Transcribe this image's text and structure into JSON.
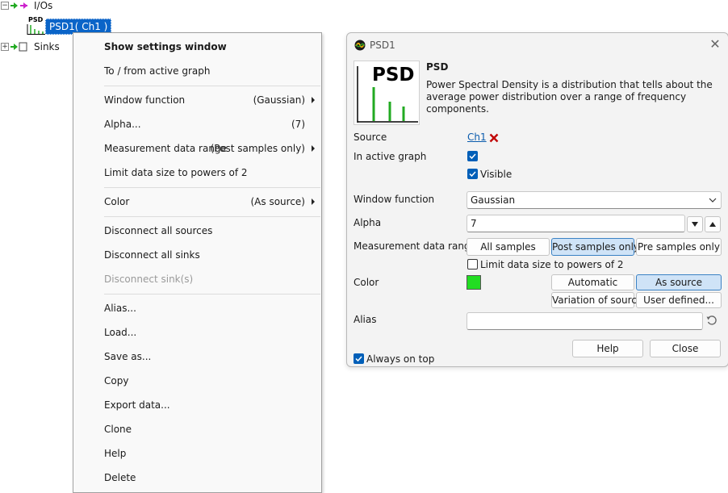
{
  "tree": {
    "ios_label": "I/Os",
    "psd_item_label": "PSD1( Ch1 )",
    "psd_thumb_text": "PSD",
    "sinks_label": "Sinks"
  },
  "menu": {
    "show_settings": "Show settings window",
    "to_from_graph": "To / from active graph",
    "window_function": "Window function",
    "window_function_value": "(Gaussian)",
    "alpha": "Alpha...",
    "alpha_value": "(7)",
    "measurement_range": "Measurement data range",
    "measurement_range_value": "(Post samples only)",
    "limit_size": "Limit data size to powers of 2",
    "color": "Color",
    "color_value": "(As source)",
    "disconnect_sources": "Disconnect all sources",
    "disconnect_sinks": "Disconnect all sinks",
    "disconnect_sink": "Disconnect sink(s)",
    "alias": "Alias...",
    "load": "Load...",
    "save_as": "Save as...",
    "copy": "Copy",
    "export_data": "Export data...",
    "clone": "Clone",
    "help": "Help",
    "delete": "Delete"
  },
  "dialog": {
    "title": "PSD1",
    "icon_text": "PSD",
    "heading": "PSD",
    "description": "Power Spectral Density is a distribution that tells about the average power distribution over a range of frequency components.",
    "source_label": "Source",
    "source_value": "Ch1",
    "in_active_graph_label": "In active graph",
    "visible_label": "Visible",
    "window_function_label": "Window function",
    "window_function_value": "Gaussian",
    "alpha_label": "Alpha",
    "alpha_value": "7",
    "measurement_range_label": "Measurement data range",
    "range_options": [
      "All samples",
      "Post samples only",
      "Pre samples only"
    ],
    "limit_label": "Limit data size to powers of 2",
    "color_label": "Color",
    "color_swatch": "#22dd22",
    "color_options": [
      "Automatic",
      "As source",
      "Variation of source",
      "User defined..."
    ],
    "alias_label": "Alias",
    "alias_value": "",
    "always_on_top_label": "Always on top",
    "help_button": "Help",
    "close_button": "Close"
  },
  "colors": {
    "selection": "#0a64c8",
    "checkbox": "#005fb8",
    "psd_bars": "#22aa22",
    "delete_x": "#c00000"
  }
}
